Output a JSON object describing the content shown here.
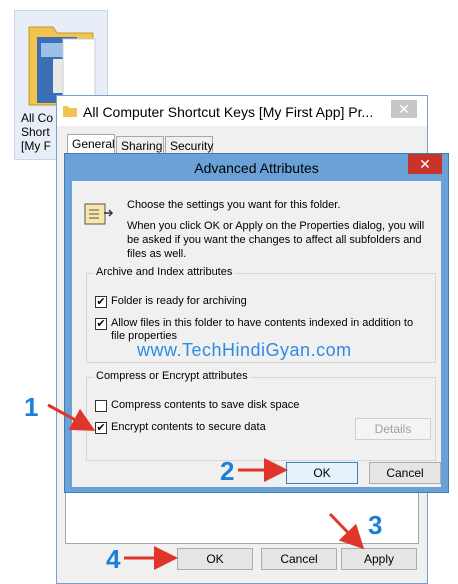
{
  "desktop_icon": {
    "label": "All Co\nShort\n[My F"
  },
  "properties": {
    "title": "All Computer Shortcut Keys [My First App] Pr...",
    "close": "✕",
    "tabs": [
      "General",
      "Sharing",
      "Security"
    ],
    "buttons": {
      "ok": "OK",
      "cancel": "Cancel",
      "apply": "Apply"
    }
  },
  "advanced": {
    "title": "Advanced Attributes",
    "close": "✕",
    "intro": "Choose the settings you want for this folder.",
    "description": "When you click OK or Apply on the Properties dialog, you will be asked if you want the changes to affect all subfolders and files as well.",
    "archive_group": {
      "label": "Archive and Index attributes",
      "options": [
        {
          "label": "Folder is ready for archiving",
          "checked": true
        },
        {
          "label": "Allow files in this folder to have contents indexed in addition to file properties",
          "checked": true
        }
      ]
    },
    "compress_group": {
      "label": "Compress or Encrypt attributes",
      "options": [
        {
          "label": "Compress contents to save disk space",
          "checked": false
        },
        {
          "label": "Encrypt contents to secure data",
          "checked": true
        }
      ],
      "details": "Details"
    },
    "buttons": {
      "ok": "OK",
      "cancel": "Cancel"
    }
  },
  "watermark": "www.TechHindiGyan.com",
  "annotations": [
    "1",
    "2",
    "3",
    "4"
  ],
  "colors": {
    "annotation": "#1e7fd8",
    "arrow": "#e0352b",
    "title_bar": "#6aa2d8",
    "close_red": "#c7342a"
  }
}
